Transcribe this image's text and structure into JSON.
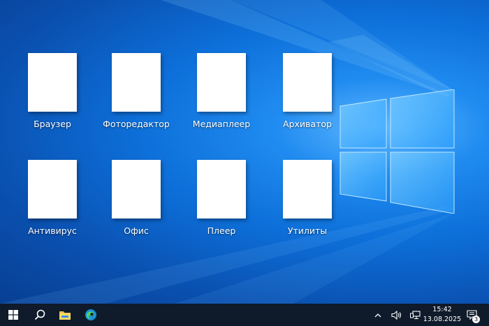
{
  "desktop": {
    "icons": [
      {
        "label": "Браузер"
      },
      {
        "label": "Фоторедактор"
      },
      {
        "label": "Медиаплеер"
      },
      {
        "label": "Архиватор"
      },
      {
        "label": "Антивирус"
      },
      {
        "label": "Офис"
      },
      {
        "label": "Плеер"
      },
      {
        "label": "Утилиты"
      }
    ]
  },
  "taskbar": {
    "pinned": [
      "start-icon",
      "search-icon",
      "file-explorer-icon",
      "edge-icon"
    ],
    "tray": {
      "time": "15:42",
      "date": "13.08.2025",
      "notification_count": "3"
    }
  },
  "colors": {
    "taskbar": "#0f1a2a",
    "desktop_accent": "#1f8bf0"
  }
}
